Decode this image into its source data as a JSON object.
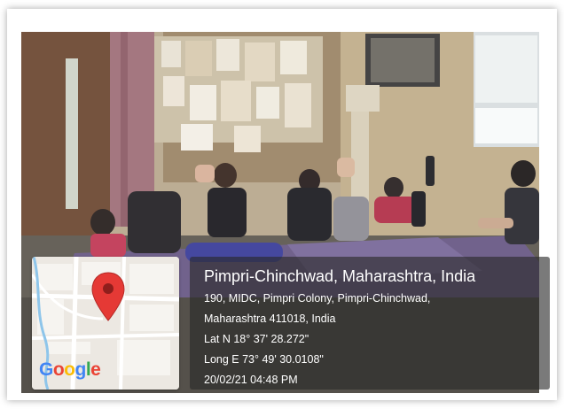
{
  "location": {
    "title": "Pimpri-Chinchwad, Maharashtra, India",
    "address_line1": "190, MIDC, Pimpri Colony, Pimpri-Chinchwad,",
    "address_line2": "Maharashtra 411018, India",
    "latitude": "Lat N 18° 37' 28.272\"",
    "longitude": "Long E 73° 49' 30.0108\"",
    "datetime": "20/02/21 04:48 PM"
  },
  "map": {
    "logo_letters": [
      {
        "char": "G",
        "color": "#4285F4"
      },
      {
        "char": "o",
        "color": "#EA4335"
      },
      {
        "char": "o",
        "color": "#FBBC05"
      },
      {
        "char": "g",
        "color": "#4285F4"
      },
      {
        "char": "l",
        "color": "#34A853"
      },
      {
        "char": "e",
        "color": "#EA4335"
      }
    ],
    "pin_color": "#E53935",
    "pin_icon": "map-pin-icon"
  }
}
